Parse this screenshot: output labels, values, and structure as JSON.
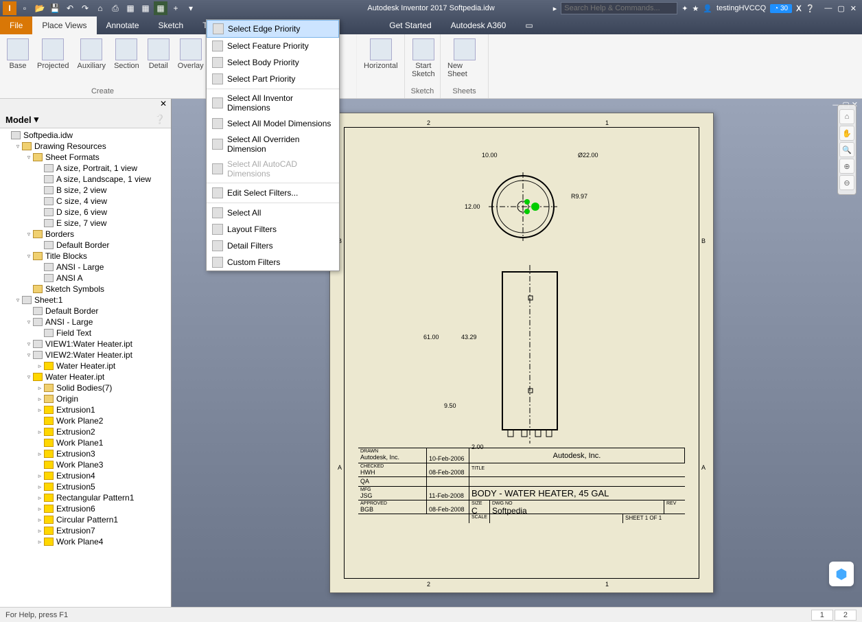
{
  "title": "Autodesk Inventor 2017    Softpedia.idw",
  "search_placeholder": "Search Help & Commands...",
  "user": "testingHVCCQ",
  "badge": "30",
  "menu": {
    "file": "File",
    "tabs": [
      "Place Views",
      "Annotate",
      "Sketch",
      "Tools",
      "Get Started",
      "Autodesk A360"
    ]
  },
  "ribbon": {
    "g1": {
      "label": "Create",
      "items": [
        "Base",
        "Projected",
        "Auxiliary",
        "Section",
        "Detail",
        "Overlay"
      ]
    },
    "g2": {
      "items": [
        "Horizontal"
      ]
    },
    "g3": {
      "label": "Sketch",
      "items": [
        "Start Sketch"
      ]
    },
    "g4": {
      "label": "Sheets",
      "items": [
        "New Sheet"
      ]
    }
  },
  "dropdown": {
    "grp1": [
      "Select Edge Priority",
      "Select Feature Priority",
      "Select Body Priority",
      "Select Part Priority"
    ],
    "grp2": [
      "Select All Inventor Dimensions",
      "Select All Model Dimensions",
      "Select All Overriden Dimension",
      "Select All AutoCAD Dimensions"
    ],
    "grp3": [
      "Edit Select Filters..."
    ],
    "grp4": [
      "Select All",
      "Layout Filters",
      "Detail Filters",
      "Custom Filters"
    ]
  },
  "model_panel": {
    "title": "Model"
  },
  "tree": [
    {
      "d": 0,
      "e": "",
      "i": "file",
      "t": "Softpedia.idw"
    },
    {
      "d": 1,
      "e": "▿",
      "i": "folder",
      "t": "Drawing Resources"
    },
    {
      "d": 2,
      "e": "▿",
      "i": "folder",
      "t": "Sheet Formats"
    },
    {
      "d": 3,
      "e": "",
      "i": "file",
      "t": "A size, Portrait, 1 view"
    },
    {
      "d": 3,
      "e": "",
      "i": "file",
      "t": "A size, Landscape, 1 view"
    },
    {
      "d": 3,
      "e": "",
      "i": "file",
      "t": "B size, 2 view"
    },
    {
      "d": 3,
      "e": "",
      "i": "file",
      "t": "C size, 4 view"
    },
    {
      "d": 3,
      "e": "",
      "i": "file",
      "t": "D size, 6 view"
    },
    {
      "d": 3,
      "e": "",
      "i": "file",
      "t": "E size, 7 view"
    },
    {
      "d": 2,
      "e": "▿",
      "i": "folder",
      "t": "Borders"
    },
    {
      "d": 3,
      "e": "",
      "i": "file",
      "t": "Default Border"
    },
    {
      "d": 2,
      "e": "▿",
      "i": "folder",
      "t": "Title Blocks"
    },
    {
      "d": 3,
      "e": "",
      "i": "file",
      "t": "ANSI - Large"
    },
    {
      "d": 3,
      "e": "",
      "i": "file",
      "t": "ANSI A"
    },
    {
      "d": 2,
      "e": "",
      "i": "folder",
      "t": "Sketch Symbols"
    },
    {
      "d": 1,
      "e": "▿",
      "i": "file",
      "t": "Sheet:1"
    },
    {
      "d": 2,
      "e": "",
      "i": "file",
      "t": "Default Border"
    },
    {
      "d": 2,
      "e": "▿",
      "i": "file",
      "t": "ANSI - Large"
    },
    {
      "d": 3,
      "e": "",
      "i": "file",
      "t": "Field Text"
    },
    {
      "d": 2,
      "e": "▿",
      "i": "file",
      "t": "VIEW1:Water Heater.ipt"
    },
    {
      "d": 2,
      "e": "▿",
      "i": "file",
      "t": "VIEW2:Water Heater.ipt"
    },
    {
      "d": 3,
      "e": "▹",
      "i": "part",
      "t": "Water Heater.ipt"
    },
    {
      "d": 2,
      "e": "▿",
      "i": "part",
      "t": "Water Heater.ipt"
    },
    {
      "d": 3,
      "e": "▹",
      "i": "folder",
      "t": "Solid Bodies(7)"
    },
    {
      "d": 3,
      "e": "▹",
      "i": "folder",
      "t": "Origin"
    },
    {
      "d": 3,
      "e": "▹",
      "i": "part",
      "t": "Extrusion1"
    },
    {
      "d": 3,
      "e": "",
      "i": "part",
      "t": "Work Plane2"
    },
    {
      "d": 3,
      "e": "▹",
      "i": "part",
      "t": "Extrusion2"
    },
    {
      "d": 3,
      "e": "",
      "i": "part",
      "t": "Work Plane1"
    },
    {
      "d": 3,
      "e": "▹",
      "i": "part",
      "t": "Extrusion3"
    },
    {
      "d": 3,
      "e": "",
      "i": "part",
      "t": "Work Plane3"
    },
    {
      "d": 3,
      "e": "▹",
      "i": "part",
      "t": "Extrusion4"
    },
    {
      "d": 3,
      "e": "▹",
      "i": "part",
      "t": "Extrusion5"
    },
    {
      "d": 3,
      "e": "▹",
      "i": "part",
      "t": "Rectangular Pattern1"
    },
    {
      "d": 3,
      "e": "▹",
      "i": "part",
      "t": "Extrusion6"
    },
    {
      "d": 3,
      "e": "▹",
      "i": "part",
      "t": "Circular Pattern1"
    },
    {
      "d": 3,
      "e": "▹",
      "i": "part",
      "t": "Extrusion7"
    },
    {
      "d": 3,
      "e": "▹",
      "i": "part",
      "t": "Work Plane4"
    }
  ],
  "dims": {
    "d1": "10.00",
    "d2": "Ø22.00",
    "d3": "R9.97",
    "d4": "12.00",
    "d5": "61.00",
    "d6": "43.29",
    "d7": "9.50",
    "d8": "2.00"
  },
  "tblock": {
    "drawn": "DRAWN",
    "company1": "Autodesk, Inc.",
    "date1": "10-Feb-2006",
    "company2": "Autodesk, Inc.",
    "checked": "CHECKED",
    "hwh": "HWH",
    "date2": "08-Feb-2008",
    "titlelbl": "TITLE",
    "qa": "QA",
    "mfg": "MFG",
    "jsg": "JSG",
    "date3": "11-Feb-2008",
    "title": "BODY - WATER HEATER, 45 GAL",
    "approved": "APPROVED",
    "bgb": "BGB",
    "date4": "08-Feb-2008",
    "sizelbl": "SIZE",
    "size": "C",
    "scalelbl": "SCALE",
    "dwglbl": "DWG NO",
    "dwg": "Softpedia",
    "revlbl": "REV",
    "sheet": "SHEET 1  OF  1"
  },
  "grid": {
    "a": "A",
    "b": "B",
    "c1": "1",
    "c2": "2"
  },
  "status": {
    "text": "For Help, press F1",
    "t1": "1",
    "t2": "2"
  }
}
